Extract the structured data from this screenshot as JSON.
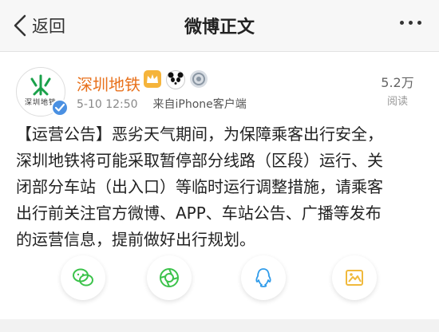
{
  "header": {
    "back_label": "返回",
    "title": "微博正文"
  },
  "post": {
    "avatar_text": "深圳地铁",
    "user_name": "深圳地铁",
    "timestamp": "5-10 12:50",
    "source": "来自iPhone客户端",
    "read_count": "5.2万",
    "read_label": "阅读",
    "text_lines": [
      "【运营公告】恶劣天气期间，为保障乘客出行安全，",
      "深圳地铁将可能采取暂停部分线路（区段）运行、关",
      "闭部分车站（出入口）等临时运行调整措施，请乘客",
      "出行前关注官方微博、APP、车站公告、广播等发布",
      "的运营信息，提前做好出行规划。"
    ]
  },
  "share": {
    "items": [
      "wechat-icon",
      "moments-icon",
      "qq-icon",
      "save-image-icon"
    ]
  },
  "colors": {
    "brand_orange": "#e8711c",
    "metro_green": "#1aa14a",
    "share_green": "#3cc34b",
    "share_blue": "#2f9bea",
    "share_yellow": "#f0b93c"
  }
}
